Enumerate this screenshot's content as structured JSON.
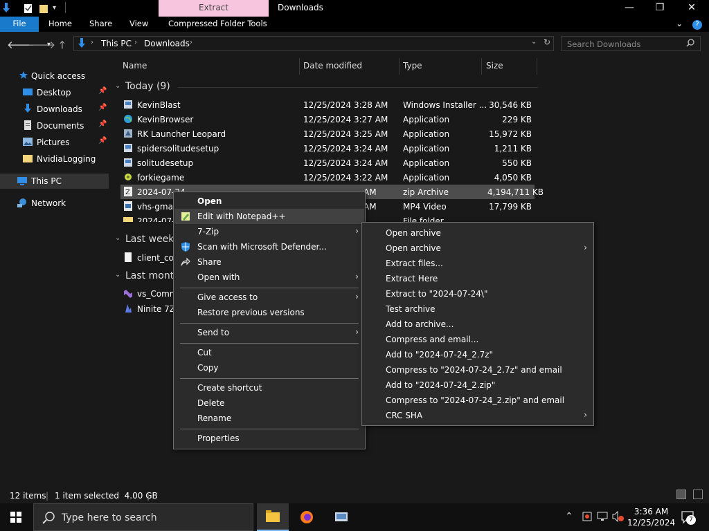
{
  "window": {
    "context_tab": "Extract",
    "title": "Downloads",
    "minimize": "—",
    "maximize": "❐",
    "close": "✕"
  },
  "ribbon": {
    "tabs": [
      "File",
      "Home",
      "Share",
      "View",
      "Compressed Folder Tools"
    ],
    "chevron": "⌄",
    "help": "?"
  },
  "address": {
    "crumbs": [
      "This PC",
      "Downloads"
    ],
    "search_placeholder": "Search Downloads"
  },
  "nav": {
    "items": [
      {
        "label": "Quick access",
        "icon": "star-icon"
      },
      {
        "label": "Desktop",
        "icon": "desktop-icon",
        "pinned": true
      },
      {
        "label": "Downloads",
        "icon": "download-icon",
        "pinned": true
      },
      {
        "label": "Documents",
        "icon": "documents-icon",
        "pinned": true
      },
      {
        "label": "Pictures",
        "icon": "pictures-icon",
        "pinned": true
      },
      {
        "label": "NvidiaLogging",
        "icon": "folder-icon"
      },
      {
        "label": "This PC",
        "icon": "computer-icon"
      },
      {
        "label": "Network",
        "icon": "network-icon"
      }
    ]
  },
  "columns": {
    "name": "Name",
    "date": "Date modified",
    "type": "Type",
    "size": "Size"
  },
  "groups": {
    "today": "Today (9)",
    "last_week": "Last week",
    "last_month": "Last month"
  },
  "files": {
    "today": [
      {
        "name": "KevinBlast",
        "date": "12/25/2024 3:28 AM",
        "type": "Windows Installer ...",
        "size": "30,546 KB"
      },
      {
        "name": "KevinBrowser",
        "date": "12/25/2024 3:27 AM",
        "type": "Application",
        "size": "229 KB"
      },
      {
        "name": "RK Launcher Leopard",
        "date": "12/25/2024 3:25 AM",
        "type": "Application",
        "size": "15,972 KB"
      },
      {
        "name": "spidersolitudesetup",
        "date": "12/25/2024 3:24 AM",
        "type": "Application",
        "size": "1,211 KB"
      },
      {
        "name": "solitudesetup",
        "date": "12/25/2024 3:24 AM",
        "type": "Application",
        "size": "550 KB"
      },
      {
        "name": "forkiegame",
        "date": "12/25/2024 3:22 AM",
        "type": "Application",
        "size": "4,050 KB"
      },
      {
        "name": "2024-07-24",
        "date": "",
        "type": "zip Archive",
        "size": "4,194,711 KB"
      },
      {
        "name": "vhs-gma-",
        "date": "",
        "type": "MP4 Video",
        "size": "17,799 KB"
      },
      {
        "name": "2024-07-2",
        "date": "",
        "type": "File folder",
        "size": ""
      }
    ],
    "last_week": [
      {
        "name": "client_cor"
      }
    ],
    "last_month": [
      {
        "name": "vs_Comm"
      },
      {
        "name": "Ninite 7Zi"
      }
    ]
  },
  "partial_text": {
    "date_am_1": "AM",
    "date_am_2": "AM"
  },
  "context_menu": {
    "items": [
      {
        "label": "Open",
        "bold": true
      },
      {
        "label": "Edit with Notepad++",
        "icon": "notepad-icon",
        "highlight": true
      },
      {
        "label": "7-Zip",
        "submenu": true
      },
      {
        "label": "Scan with Microsoft Defender...",
        "icon": "defender-shield-icon"
      },
      {
        "label": "Share",
        "icon": "share-icon"
      },
      {
        "label": "Open with",
        "submenu": true
      },
      {
        "label": "Give access to",
        "submenu": true
      },
      {
        "label": "Restore previous versions"
      },
      {
        "label": "Send to",
        "submenu": true
      },
      {
        "label": "Cut"
      },
      {
        "label": "Copy"
      },
      {
        "label": "Create shortcut"
      },
      {
        "label": "Delete"
      },
      {
        "label": "Rename"
      },
      {
        "label": "Properties"
      }
    ]
  },
  "sevenzip_menu": {
    "items": [
      {
        "label": "Open archive"
      },
      {
        "label": "Open archive",
        "submenu": true
      },
      {
        "label": "Extract files..."
      },
      {
        "label": "Extract Here"
      },
      {
        "label": "Extract to \"2024-07-24\\\""
      },
      {
        "label": "Test archive"
      },
      {
        "label": "Add to archive..."
      },
      {
        "label": "Compress and email..."
      },
      {
        "label": "Add to \"2024-07-24_2.7z\""
      },
      {
        "label": "Compress to \"2024-07-24_2.7z\" and email"
      },
      {
        "label": "Add to \"2024-07-24_2.zip\""
      },
      {
        "label": "Compress to \"2024-07-24_2.zip\" and email"
      },
      {
        "label": "CRC SHA",
        "submenu": true
      }
    ]
  },
  "status": {
    "items": "12 items",
    "selected": "1 item selected  4.00 GB"
  },
  "taskbar": {
    "search_placeholder": "Type here to search",
    "time": "3:36 AM",
    "date": "12/25/2024",
    "notifications": "7"
  }
}
